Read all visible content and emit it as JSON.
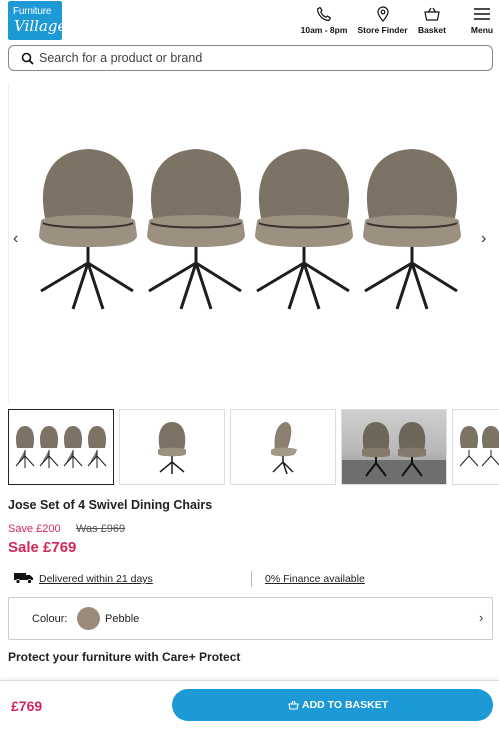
{
  "header": {
    "logo_line1": "Furniture",
    "logo_line2": "Village",
    "hours": "10am - 8pm",
    "store_finder": "Store Finder",
    "basket": "Basket",
    "menu": "Menu"
  },
  "search": {
    "placeholder": "Search for a product or brand"
  },
  "gallery": {
    "prev": "‹",
    "next": "›"
  },
  "product": {
    "title": "Jose Set of 4 Swivel Dining Chairs",
    "save": "Save £200",
    "was": "Was £969",
    "sale": "Sale £769"
  },
  "info": {
    "delivery": "Delivered within 21 days",
    "finance": "0% Finance available"
  },
  "colour": {
    "label": "Colour:",
    "value": "Pebble",
    "swatch": "#9a8a7a",
    "chevron": "›"
  },
  "protect": {
    "heading": "Protect your furniture with Care+ Protect"
  },
  "bottom_bar": {
    "price": "£769",
    "button": "ADD TO BASKET"
  },
  "colors": {
    "brand_blue": "#1d9ad6",
    "sale_pink": "#d2275a"
  }
}
